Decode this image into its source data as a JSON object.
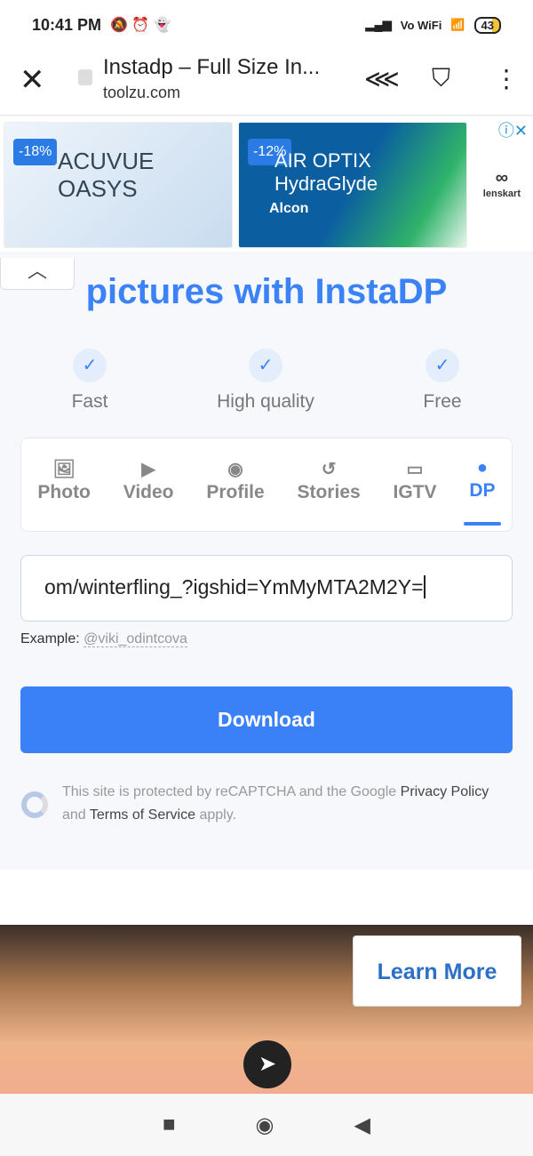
{
  "status": {
    "time": "10:41 PM",
    "wifi_label": "Vo WiFi",
    "battery": "43"
  },
  "browser": {
    "title": "Instadp – Full Size In...",
    "domain": "toolzu.com"
  },
  "ad_top": {
    "item1": {
      "discount": "-18%",
      "brand": "ACUVUE OASYS"
    },
    "item2": {
      "discount": "-12%",
      "brand": "AIR OPTIX HydraGlyde",
      "maker": "Alcon"
    },
    "advertiser": "lenskart"
  },
  "hero": {
    "title": "pictures with InstaDP"
  },
  "features": [
    "Fast",
    "High quality",
    "Free"
  ],
  "tabs": [
    {
      "label": "Photo",
      "icon": "image-icon"
    },
    {
      "label": "Video",
      "icon": "play-icon"
    },
    {
      "label": "Profile",
      "icon": "user-circle-icon"
    },
    {
      "label": "Stories",
      "icon": "history-icon"
    },
    {
      "label": "IGTV",
      "icon": "tv-icon"
    },
    {
      "label": "DP",
      "icon": "user-icon",
      "active": true
    }
  ],
  "input": {
    "value": "om/winterfling_?igshid=YmMyMTA2M2Y="
  },
  "example": {
    "label": "Example:",
    "value": "@viki_odintcova"
  },
  "download_label": "Download",
  "recaptcha": {
    "t1": "This site is protected by reCAPTCHA and the Google",
    "privacy": "Privacy Policy",
    "t2": "and",
    "terms": "Terms of Service",
    "t3": "apply."
  },
  "ad_bottom": {
    "cta": "Learn More"
  },
  "colors": {
    "accent": "#3a80f6"
  }
}
